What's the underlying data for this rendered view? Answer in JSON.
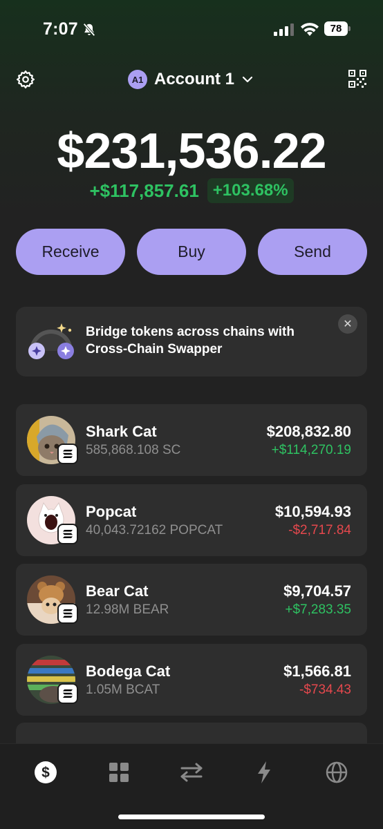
{
  "status_bar": {
    "time": "7:07",
    "battery": "78"
  },
  "header": {
    "account_initials": "A1",
    "account_name": "Account 1"
  },
  "portfolio": {
    "balance": "$231,536.22",
    "change_abs": "+$117,857.61",
    "change_pct": "+103.68%"
  },
  "actions": [
    {
      "label": "Receive"
    },
    {
      "label": "Buy"
    },
    {
      "label": "Send"
    }
  ],
  "banner": {
    "text": "Bridge tokens across chains with Cross-Chain Swapper"
  },
  "tokens": [
    {
      "name": "Shark Cat",
      "amount": "585,868.108 SC",
      "value": "$208,832.80",
      "pnl": "+$114,270.19",
      "pnl_sign": "positive"
    },
    {
      "name": "Popcat",
      "amount": "40,043.72162 POPCAT",
      "value": "$10,594.93",
      "pnl": "-$2,717.84",
      "pnl_sign": "negative"
    },
    {
      "name": "Bear Cat",
      "amount": "12.98M BEAR",
      "value": "$9,704.57",
      "pnl": "+$7,283.35",
      "pnl_sign": "positive"
    },
    {
      "name": "Bodega Cat",
      "amount": "1.05M BCAT",
      "value": "$1,566.81",
      "pnl": "-$734.43",
      "pnl_sign": "negative"
    }
  ],
  "nav": [
    {
      "icon": "dollar-icon",
      "active": true
    },
    {
      "icon": "grid-icon",
      "active": false
    },
    {
      "icon": "swap-icon",
      "active": false
    },
    {
      "icon": "lightning-icon",
      "active": false
    },
    {
      "icon": "globe-icon",
      "active": false
    }
  ],
  "colors": {
    "accent": "#ab9ff2",
    "positive": "#2ec262",
    "negative": "#e5484d",
    "card": "#2e2e2e"
  }
}
